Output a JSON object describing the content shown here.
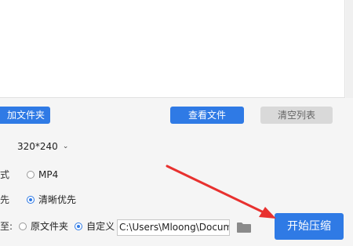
{
  "file_list": {
    "area": ""
  },
  "toolbar": {
    "add_folder_label": "加文件夹",
    "view_files_label": "查看文件",
    "clear_list_label": "清空列表"
  },
  "settings": {
    "resolution_value": "320*240",
    "format": {
      "label_fragment": "式",
      "option_mp4": "MP4"
    },
    "priority": {
      "label_fragment": "先",
      "option_clarity": "清晰优先",
      "option_clarity_selected": true
    }
  },
  "output": {
    "label_fragment": "至:",
    "option_original": "原文件夹",
    "option_custom": "自定义",
    "custom_selected": true,
    "path_value": "C:\\Users\\Mloong\\Docume"
  },
  "start_button_label": "开始压缩",
  "colors": {
    "accent": "#2f7ae5",
    "arrow": "#e8312f",
    "disabled_button": "#d9d9d9"
  }
}
